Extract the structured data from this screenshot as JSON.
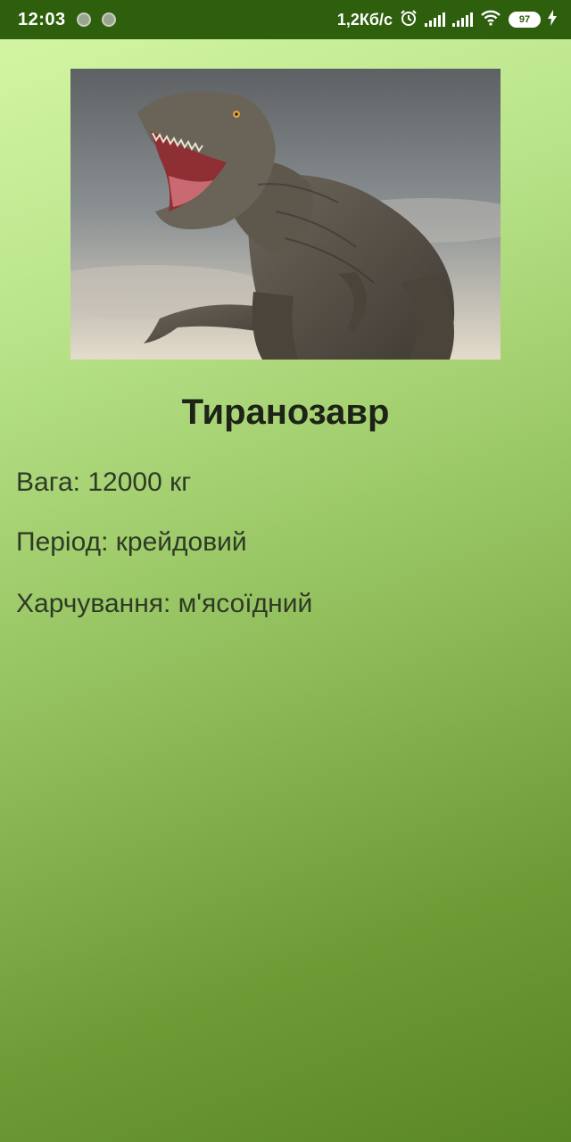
{
  "status_bar": {
    "time": "12:03",
    "network_speed": "1,2Кб/с",
    "battery_level": "97"
  },
  "dinosaur": {
    "name": "Тиранозавр",
    "weight": "Вага: 12000 кг",
    "period": "Період: крейдовий",
    "diet": "Харчування: м'ясоїдний"
  },
  "colors": {
    "status_bar": "#2d5f0d",
    "gradient_top": "#d6f7a6",
    "gradient_bottom": "#5a8725",
    "title_text": "#1d2417",
    "info_text": "#2f3a26"
  }
}
